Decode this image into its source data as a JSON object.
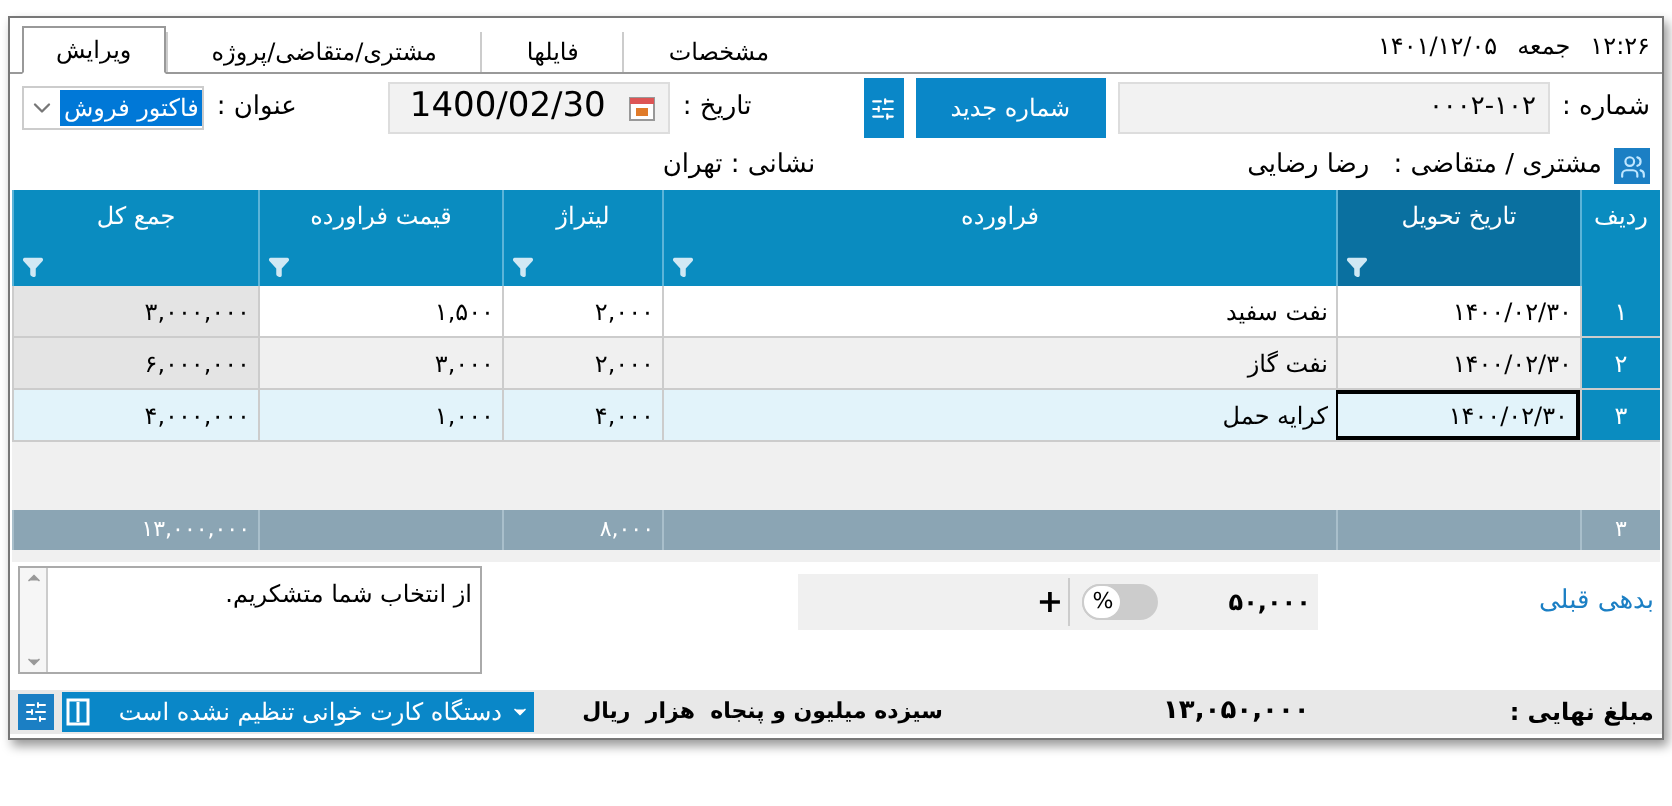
{
  "clock": {
    "time": "۱۲:۲۶",
    "weekday": "جمعه",
    "date": "۱۴۰۱/۱۲/۰۵"
  },
  "tabs": [
    {
      "label": "مشخصات",
      "selected": false
    },
    {
      "label": "فایلها",
      "selected": false
    },
    {
      "label": "مشتری/متقاضی/پروژه",
      "selected": false
    },
    {
      "label": "ویرایش",
      "selected": true
    }
  ],
  "header": {
    "number_label": "شماره :",
    "number": "۰۰۰۲-۱۰۲",
    "new_number_button": "شماره جدید",
    "date_label": "تاریخ :",
    "date": "1400/02/30",
    "title_label": "عنوان :",
    "title": "فاکتور فروش",
    "customer_label": "مشتری / متقاضی :",
    "customer": "رضا رضایی",
    "address": "نشانی : تهران"
  },
  "table": {
    "columns": [
      {
        "label": "ردیف",
        "filter": false,
        "selected": false
      },
      {
        "label": "تاریخ تحویل",
        "filter": true,
        "selected": true
      },
      {
        "label": "فراورده",
        "filter": true,
        "selected": false
      },
      {
        "label": "لیتراژ",
        "filter": true,
        "selected": false
      },
      {
        "label": "قیمت فراورده",
        "filter": true,
        "selected": false
      },
      {
        "label": "جمع کل",
        "filter": true,
        "selected": false
      }
    ],
    "rows": [
      {
        "selected": false,
        "cells": [
          "۱",
          "۱۴۰۰/۰۲/۳۰",
          "نفت سفید",
          "۲,۰۰۰",
          "۱,۵۰۰",
          "۳,۰۰۰,۰۰۰"
        ]
      },
      {
        "selected": false,
        "cells": [
          "۲",
          "۱۴۰۰/۰۲/۳۰",
          "نفت گاز",
          "۲,۰۰۰",
          "۳,۰۰۰",
          "۶,۰۰۰,۰۰۰"
        ]
      },
      {
        "selected": true,
        "cells": [
          "۳",
          "۱۴۰۰/۰۲/۳۰",
          "کرایه حمل",
          "۴,۰۰۰",
          "۱,۰۰۰",
          "۴,۰۰۰,۰۰۰"
        ]
      }
    ],
    "totals": {
      "row_count": "۳",
      "liters": "۸,۰۰۰",
      "grand_total": "۱۳,۰۰۰,۰۰۰"
    }
  },
  "previous_debt": {
    "label": "بدهی قبلی",
    "amount": "۵۰,۰۰۰",
    "percent_label": "%",
    "percent_on": false,
    "add": "+"
  },
  "note": "از انتخاب شما متشکریم.",
  "status_bar": {
    "final_label": "مبلغ نهایی :",
    "final_amount": "۱۳,۰۵۰,۰۰۰",
    "in_words": "سیزده میلیون و پنجاه  هزار  ریال",
    "card_reader": "دستگاه کارت خوانی تنظیم نشده است"
  }
}
